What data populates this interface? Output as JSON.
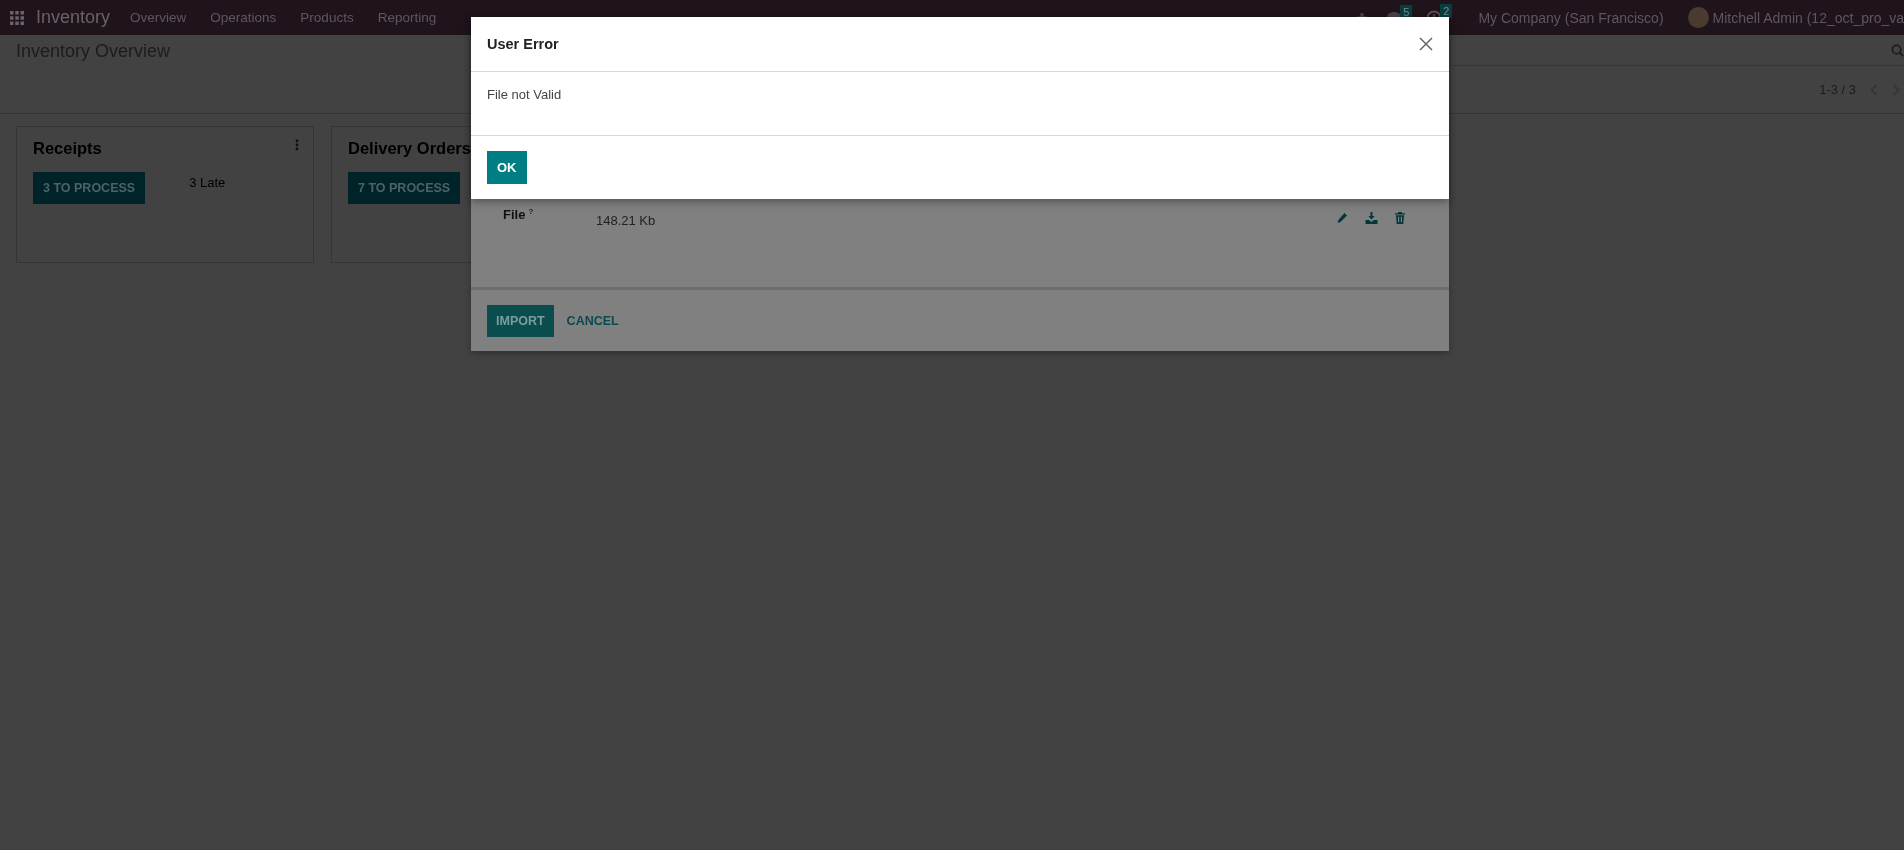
{
  "navbar": {
    "app_name": "Inventory",
    "menu": [
      "Overview",
      "Operations",
      "Products",
      "Reporting"
    ],
    "messages_badge": "5",
    "activities_badge": "2",
    "company": "My Company (San Francisco)",
    "user": "Mitchell Admin (12_oct_pro_va"
  },
  "control_panel": {
    "title": "Inventory Overview",
    "pager": "1-3 / 3"
  },
  "cards": [
    {
      "title": "Receipts",
      "button": "3 TO PROCESS",
      "late": "3 Late"
    },
    {
      "title": "Delivery Orders",
      "button": "7 TO PROCESS"
    }
  ],
  "import_dialog": {
    "field_label": "File",
    "tooltip_mark": "?",
    "file_size": "148.21 Kb",
    "buttons": [
      {
        "label": "IMPORT",
        "kind": "primary"
      },
      {
        "label": "CANCEL",
        "kind": "link"
      }
    ]
  },
  "error_dialog": {
    "title": "User Error",
    "message": "File not Valid",
    "buttons": [
      {
        "label": "OK",
        "kind": "primary"
      }
    ]
  }
}
